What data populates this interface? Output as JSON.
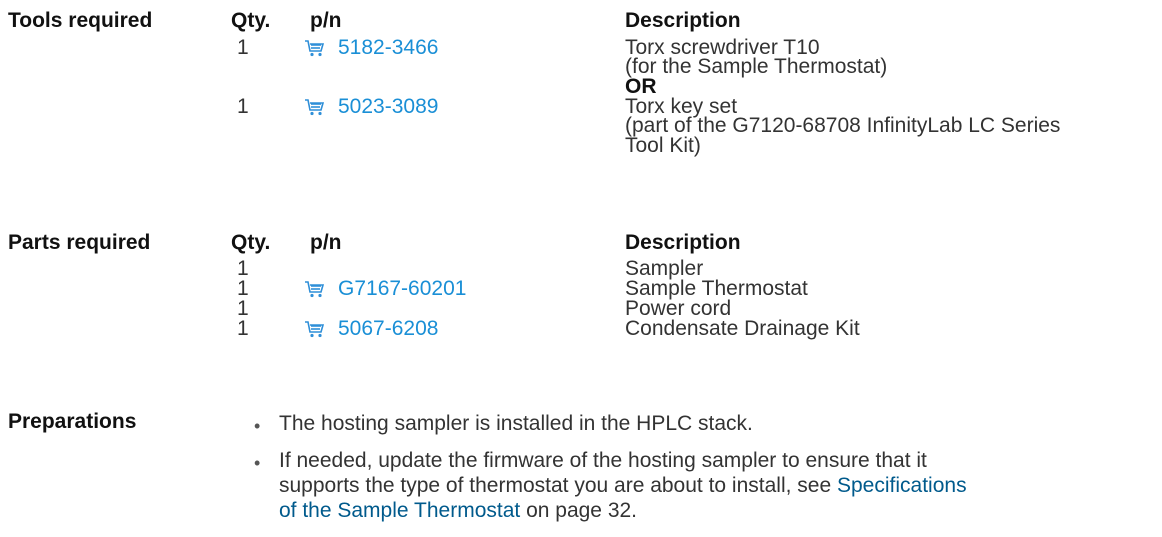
{
  "tools": {
    "section_label": "Tools required",
    "headers": {
      "qty": "Qty.",
      "pn": "p/n",
      "description": "Description"
    },
    "rows": [
      {
        "qty": "1",
        "pn": "5182-3466",
        "has_cart": true,
        "desc_lines": [
          "Torx screwdriver T10",
          "(for the Sample Thermostat)"
        ]
      },
      {
        "separator": "OR"
      },
      {
        "qty": "1",
        "pn": "5023-3089",
        "has_cart": true,
        "desc_lines": [
          "Torx key set",
          "(part of the G7120-68708 InfinityLab LC Series",
          "Tool Kit)"
        ]
      }
    ]
  },
  "parts": {
    "section_label": "Parts required",
    "headers": {
      "qty": "Qty.",
      "pn": "p/n",
      "description": "Description"
    },
    "rows": [
      {
        "qty": "1",
        "pn": "",
        "has_cart": false,
        "description": "Sampler"
      },
      {
        "qty": "1",
        "pn": "G7167-60201",
        "has_cart": true,
        "description": "Sample Thermostat"
      },
      {
        "qty": "1",
        "pn": "",
        "has_cart": false,
        "description": "Power cord"
      },
      {
        "qty": "1",
        "pn": "5067-6208",
        "has_cart": true,
        "description": "Condensate Drainage Kit"
      }
    ]
  },
  "preparations": {
    "section_label": "Preparations",
    "bullet_char": "•",
    "items": [
      {
        "text": "The hosting sampler is installed in the HPLC stack."
      },
      {
        "line1": "If needed, update the firmware of the hosting sampler to ensure that it",
        "line2_pre": "supports the type of thermostat you are about to install, see ",
        "line2_link": "Specifications",
        "line3_link": "of the Sample Thermostat",
        "line3_post": " on page 32."
      }
    ]
  },
  "icons": {
    "cart": "shopping-cart-icon"
  },
  "colors": {
    "link": "#1a8fd6",
    "xref": "#005a8c",
    "cart": "#2f8fd8"
  }
}
